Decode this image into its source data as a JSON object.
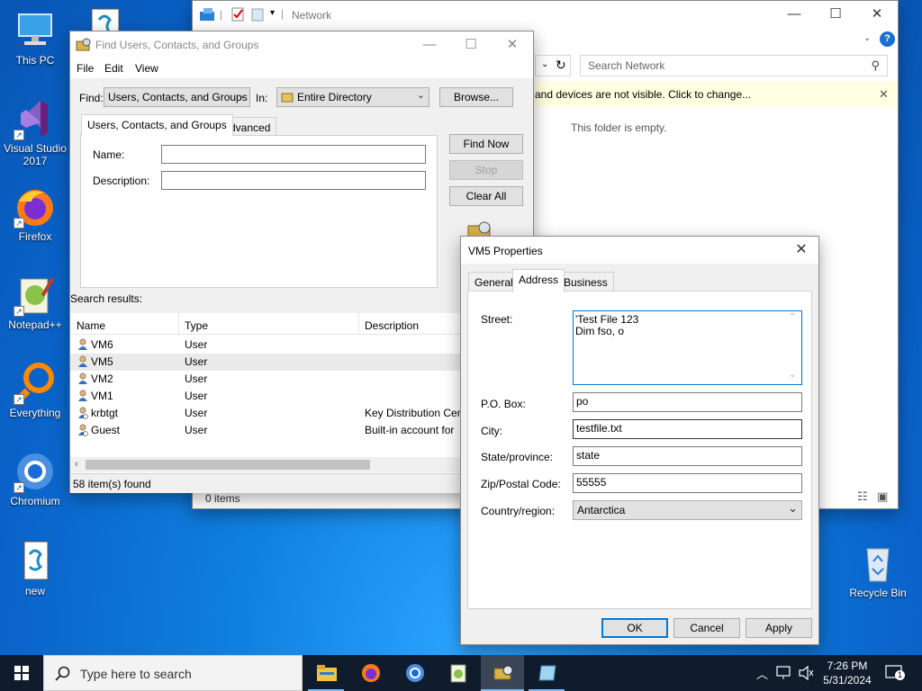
{
  "desktop": {
    "icons": [
      {
        "label": "This PC"
      },
      {
        "label": "Visual Studio 2017"
      },
      {
        "label": "Firefox"
      },
      {
        "label": "Notepad++"
      },
      {
        "label": "Everything"
      },
      {
        "label": "Chromium"
      },
      {
        "label": "new"
      },
      {
        "label": "Recycle Bin"
      }
    ]
  },
  "network_window": {
    "title": "Network",
    "search_placeholder": "Search Network",
    "infobar": "and devices are not visible. Click to change...",
    "empty": "This folder is empty.",
    "status": "0 items"
  },
  "find_window": {
    "title": "Find Users, Contacts, and Groups",
    "menu": [
      "File",
      "Edit",
      "View"
    ],
    "find_label": "Find:",
    "find_value": "Users, Contacts, and Groups",
    "in_label": "In:",
    "in_value": "Entire Directory",
    "browse": "Browse...",
    "tabs": [
      "Users, Contacts, and Groups",
      "Advanced"
    ],
    "name_label": "Name:",
    "description_label": "Description:",
    "find_now": "Find Now",
    "stop": "Stop",
    "clear_all": "Clear All",
    "results_label": "Search results:",
    "columns": [
      "Name",
      "Type",
      "Description"
    ],
    "rows": [
      {
        "name": "VM6",
        "type": "User",
        "description": ""
      },
      {
        "name": "VM5",
        "type": "User",
        "description": ""
      },
      {
        "name": "VM2",
        "type": "User",
        "description": ""
      },
      {
        "name": "VM1",
        "type": "User",
        "description": ""
      },
      {
        "name": "krbtgt",
        "type": "User",
        "description": "Key Distribution Cen"
      },
      {
        "name": "Guest",
        "type": "User",
        "description": "Built-in account for"
      }
    ],
    "status": "58 item(s) found"
  },
  "props_dialog": {
    "title": "VM5 Properties",
    "tabs": [
      "General",
      "Address",
      "Business"
    ],
    "street_label": "Street:",
    "street_value": "'Test File 123\nDim fso, o",
    "pobox_label": "P.O. Box:",
    "pobox_value": "po",
    "city_label": "City:",
    "city_value": "testfile.txt",
    "state_label": "State/province:",
    "state_value": "state",
    "zip_label": "Zip/Postal Code:",
    "zip_value": "55555",
    "country_label": "Country/region:",
    "country_value": "Antarctica",
    "ok": "OK",
    "cancel": "Cancel",
    "apply": "Apply"
  },
  "taskbar": {
    "search_placeholder": "Type here to search",
    "time": "7:26 PM",
    "date": "5/31/2024",
    "notifications": "1"
  },
  "colors": {
    "taskbar": "#101c2c",
    "accent": "#0078d7",
    "infobar": "#ffffe1"
  }
}
